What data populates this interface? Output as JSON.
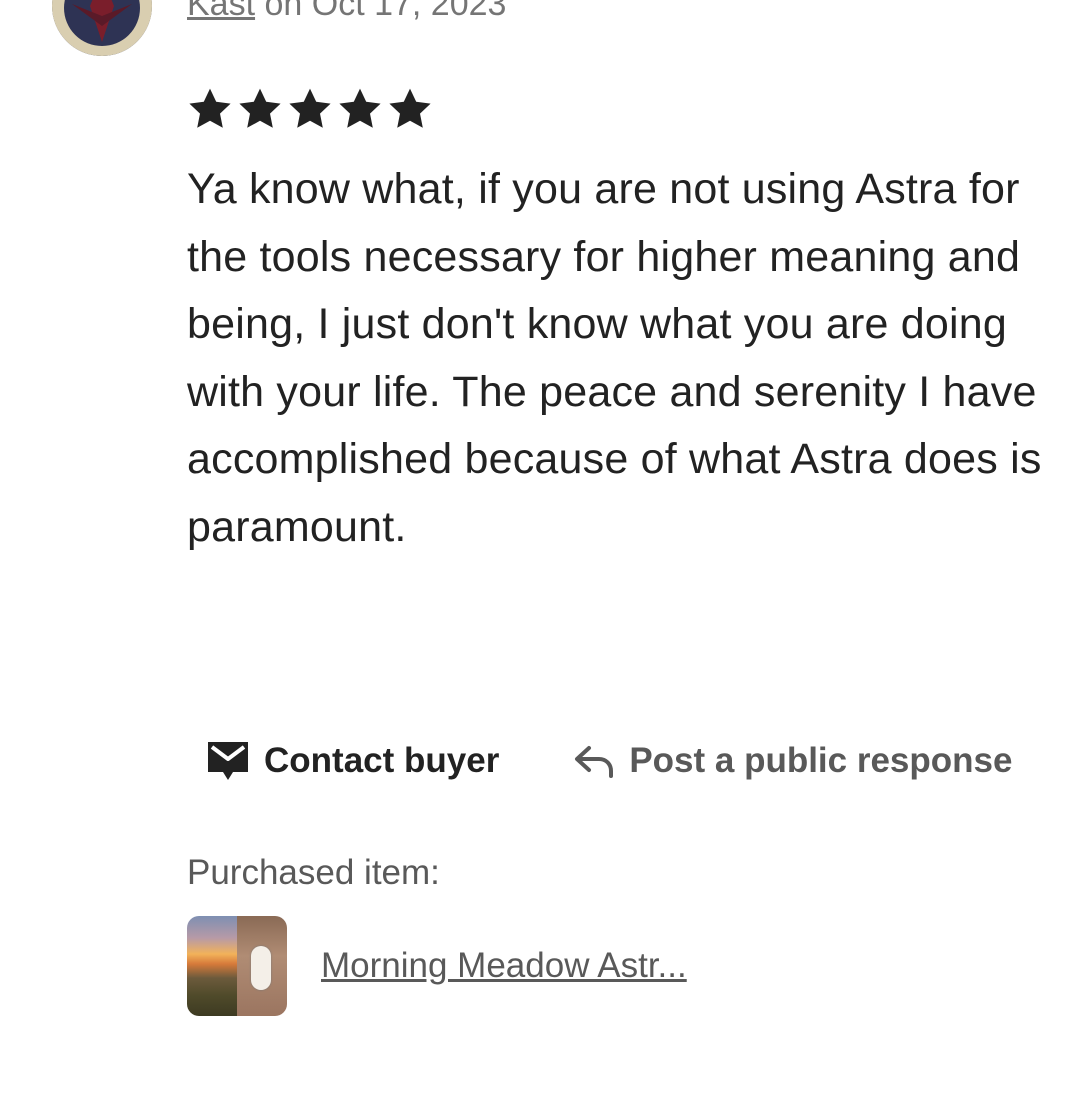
{
  "review": {
    "reviewer_name": "Kast",
    "date_text": " on Oct 17, 2023",
    "rating": 5,
    "rating_max": 5,
    "text": "Ya know what, if you are not using Astra for the tools necessary for higher meaning and being, I just don't know what you are doing with your life. The peace and serenity I have accomplished because of what Astra does is paramount."
  },
  "actions": {
    "contact_label": "Contact buyer",
    "respond_label": "Post a public response"
  },
  "purchase": {
    "label": "Purchased item:",
    "item_title": "Morning Meadow Astr..."
  },
  "icons": {
    "star": "star-icon",
    "contact": "message-icon",
    "respond": "reply-arrow-icon"
  },
  "colors": {
    "text_primary": "#222222",
    "text_secondary": "#595959",
    "star": "#222222"
  }
}
